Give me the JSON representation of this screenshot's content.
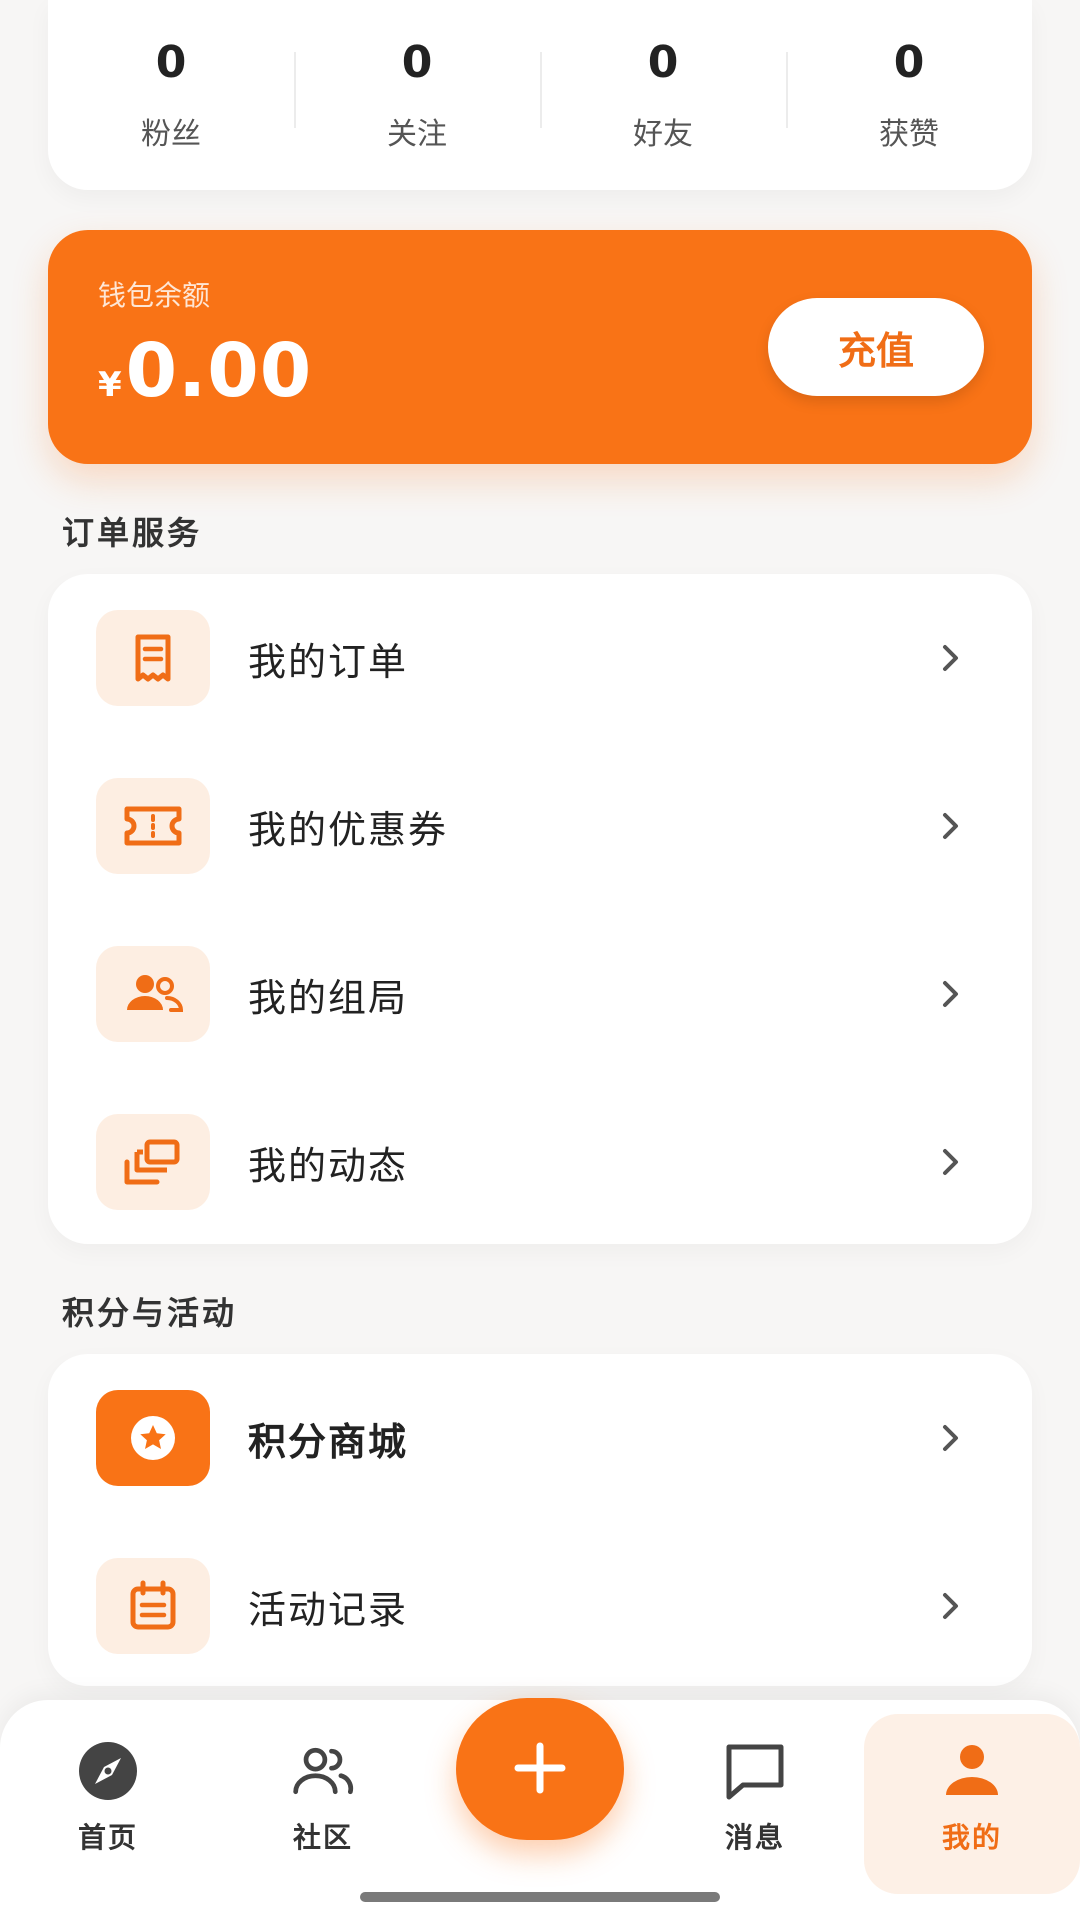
{
  "stats": [
    {
      "value": "0",
      "label": "粉丝"
    },
    {
      "value": "0",
      "label": "关注"
    },
    {
      "value": "0",
      "label": "好友"
    },
    {
      "value": "0",
      "label": "获赞"
    }
  ],
  "wallet": {
    "label": "钱包余额",
    "currency": "¥",
    "amount": "0.00",
    "recharge_label": "充值"
  },
  "order_section": {
    "title": "订单服务",
    "items": [
      {
        "label": "我的订单",
        "icon": "receipt-icon"
      },
      {
        "label": "我的优惠券",
        "icon": "ticket-icon"
      },
      {
        "label": "我的组局",
        "icon": "group-icon"
      },
      {
        "label": "我的动态",
        "icon": "moments-icon"
      }
    ]
  },
  "points_section": {
    "title": "积分与活动",
    "items": [
      {
        "label": "积分商城",
        "icon": "star-badge-icon"
      },
      {
        "label": "活动记录",
        "icon": "calendar-icon"
      }
    ]
  },
  "bottom_nav": {
    "items": [
      {
        "label": "首页",
        "icon": "compass-icon"
      },
      {
        "label": "社区",
        "icon": "community-icon"
      },
      {
        "label": "消息",
        "icon": "message-icon"
      },
      {
        "label": "我的",
        "icon": "user-icon",
        "active": true
      }
    ],
    "fab_icon": "plus-icon"
  },
  "colors": {
    "accent": "#f97316",
    "accent_light": "#fdeee2",
    "background": "#f7f6f5"
  }
}
